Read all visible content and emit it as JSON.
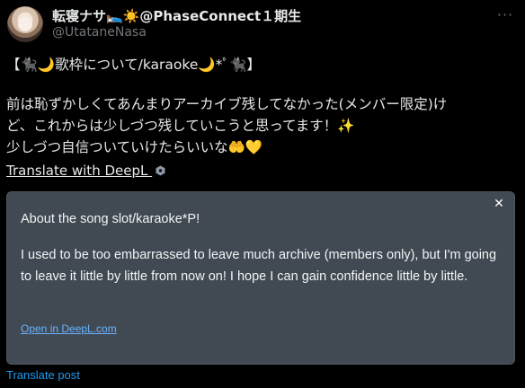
{
  "header": {
    "display_name": "転寝ナサ🛌☀️@PhaseConnect１期生",
    "handle": "@UtataneNasa",
    "more_icon": "more-horizontal-icon",
    "more_label": "···"
  },
  "tweet": {
    "line1": "【🐈‍⬛🌙歌枠について/karaoke🌙*ﾟ🐈‍⬛】",
    "line2": "前は恥ずかしくてあんまりアーカイブ残してなかった(メンバー限定)け",
    "line3": "ど、これからは少しづつ残していこうと思ってます！✨",
    "line4": "少しづつ自信ついていけたらいいな🤲💛"
  },
  "translate_link": "Translate with DeepL",
  "translation": {
    "title": "About the song slot/karaoke*P!",
    "body": "I used to be too embarrassed to leave much archive (members only), but I'm going to leave it little by little from now on! I hope I can gain confidence little by little.",
    "open_link": "Open in DeepL.com",
    "close_label": "✕"
  },
  "footer": {
    "translate_post": "Translate post"
  },
  "colors": {
    "background": "#000000",
    "panel": "#414a53",
    "link_blue": "#1d9bf0",
    "muted": "#71767b"
  }
}
